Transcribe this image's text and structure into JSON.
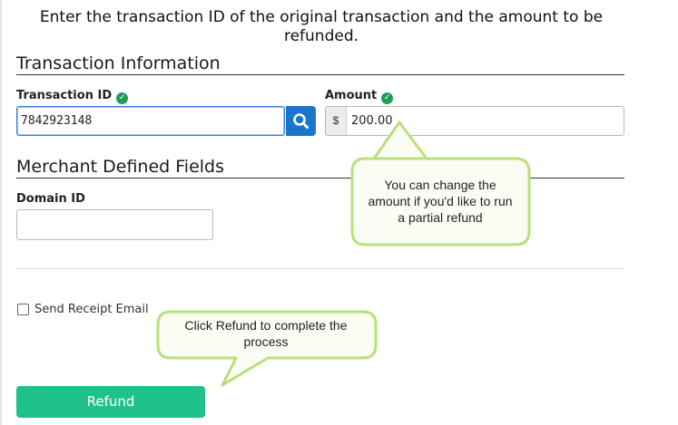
{
  "instruction": "Enter the transaction ID of the original transaction and the amount to be refunded.",
  "transaction_section": {
    "title": "Transaction Information",
    "transaction_id_label": "Transaction ID",
    "transaction_id_value": "7842923148",
    "amount_label": "Amount",
    "amount_prefix": "$",
    "amount_value": "200.00"
  },
  "merchant_section": {
    "title": "Merchant Defined Fields",
    "domain_id_label": "Domain ID",
    "domain_id_value": ""
  },
  "receipt": {
    "label": "Send Receipt Email",
    "checked": false
  },
  "refund_button": {
    "label": "Refund"
  },
  "callouts": {
    "amount_tip": "You can change the amount if you'd like to run a partial refund",
    "refund_tip": "Click Refund to complete the process"
  },
  "icons": {
    "validated": "check-circle-icon",
    "search": "search-icon"
  },
  "colors": {
    "accent_blue": "#1877cc",
    "valid_green": "#1f9d55",
    "refund_green": "#20c28a",
    "callout_fill": "#fbfdf5",
    "callout_border": "#b9e07a"
  }
}
